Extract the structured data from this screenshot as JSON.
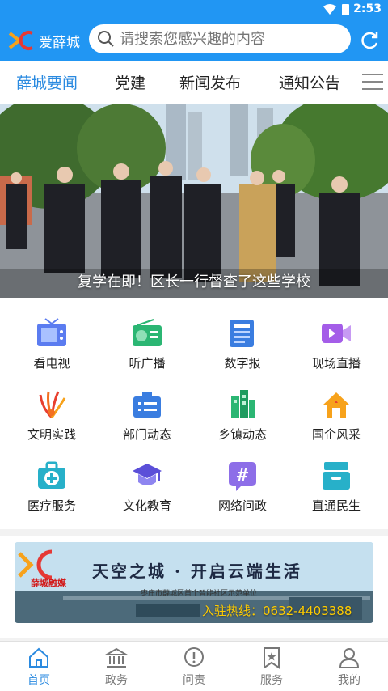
{
  "status_bar": {
    "time": "2:53"
  },
  "header": {
    "logo_text": "爱薛城",
    "search_placeholder": "请搜索您感兴趣的内容"
  },
  "tabs": [
    {
      "label": "薛城要闻",
      "active": true
    },
    {
      "label": "党建",
      "active": false
    },
    {
      "label": "新闻发布",
      "active": false
    },
    {
      "label": "通知公告",
      "active": false
    }
  ],
  "banner": {
    "caption": "复学在即！区长一行督查了这些学校"
  },
  "services": [
    {
      "label": "看电视",
      "icon": "tv-icon"
    },
    {
      "label": "听广播",
      "icon": "radio-icon"
    },
    {
      "label": "数字报",
      "icon": "newspaper-icon"
    },
    {
      "label": "现场直播",
      "icon": "live-video-icon"
    },
    {
      "label": "文明实践",
      "icon": "civilization-icon"
    },
    {
      "label": "部门动态",
      "icon": "department-icon"
    },
    {
      "label": "乡镇动态",
      "icon": "town-buildings-icon"
    },
    {
      "label": "国企风采",
      "icon": "house-icon"
    },
    {
      "label": "医疗服务",
      "icon": "medical-kit-icon"
    },
    {
      "label": "文化教育",
      "icon": "graduation-cap-icon"
    },
    {
      "label": "网络问政",
      "icon": "hashtag-icon"
    },
    {
      "label": "直通民生",
      "icon": "inbox-icon"
    }
  ],
  "ad": {
    "slogan": "天空之城 · 开启云端生活",
    "brand": "薛城融媒",
    "sub": "枣庄市薛城区首个智能社区示范单位",
    "hotline": "入驻热线：0632-4403388"
  },
  "bottom_nav": [
    {
      "label": "首页",
      "icon": "home-icon",
      "active": true
    },
    {
      "label": "政务",
      "icon": "government-icon",
      "active": false
    },
    {
      "label": "问责",
      "icon": "alert-icon",
      "active": false
    },
    {
      "label": "服务",
      "icon": "bookmark-star-icon",
      "active": false
    },
    {
      "label": "我的",
      "icon": "user-icon",
      "active": false
    }
  ],
  "colors": {
    "primary": "#2196f3",
    "active_tab": "#2a8ae0"
  }
}
